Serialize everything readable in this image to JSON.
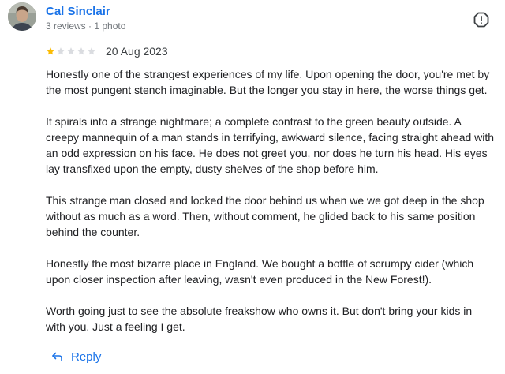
{
  "author": {
    "name": "Cal Sinclair",
    "meta": "3 reviews · 1 photo"
  },
  "icons": {
    "avatar": "avatar",
    "report": "report-icon",
    "reply": "reply-arrow-icon",
    "star_filled": "star-filled-icon",
    "star_empty": "star-empty-icon"
  },
  "rating": {
    "value": 1,
    "max": 5
  },
  "colors": {
    "link": "#1a73e8",
    "star_filled": "#fbbc04",
    "star_empty": "#dadce0",
    "text": "#202124",
    "muted": "#70757a"
  },
  "review": {
    "date": "20 Aug 2023",
    "paragraphs": [
      "Honestly one of the strangest experiences of my life. Upon opening the door, you're met by\nthe most pungent stench imaginable. But the longer you stay in here, the worse things get.",
      "It spirals into a strange nightmare; a complete contrast to the green beauty outside. A\ncreepy mannequin of a man stands in terrifying, awkward silence, facing straight ahead with\nan odd expression on his face. He does not greet you, nor does he turn his head. His eyes\nlay transfixed upon the empty, dusty shelves of the shop before him.",
      "This strange man closed and locked the door behind us when we we got deep in the shop\nwithout as much as a word. Then, without comment, he glided back to his same position\nbehind the counter.",
      "Honestly the most bizarre place in England. We bought a bottle of scrumpy cider (which\nupon closer inspection after leaving, wasn't even produced in the New Forest!).",
      "Worth going just to see the absolute freakshow who owns it. But don't bring your kids in\nwith you. Just a feeling I get."
    ]
  },
  "actions": {
    "reply_label": "Reply"
  }
}
